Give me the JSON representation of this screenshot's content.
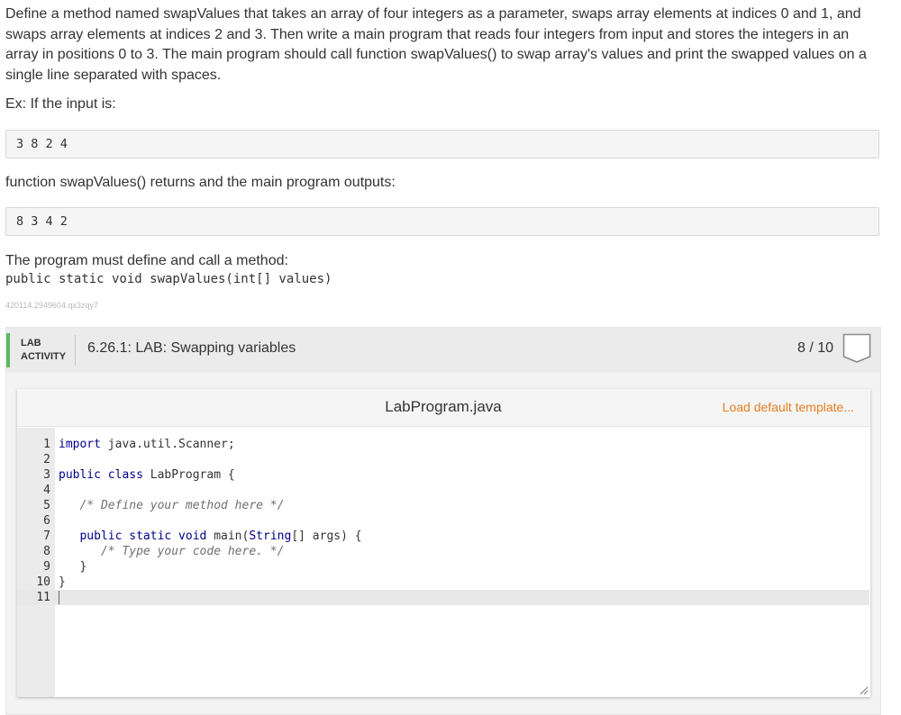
{
  "description": "Define a method named swapValues that takes an array of four integers as a parameter, swaps array elements at indices 0 and 1, and swaps array elements at indices 2 and 3. Then write a main program that reads four integers from input and stores the integers in an array in positions 0 to 3. The main program should call function swapValues() to swap array's values and print the swapped values on a single line separated with spaces.",
  "example_label": "Ex: If the input is:",
  "example_input": "3 8 2 4",
  "output_label": "function swapValues() returns and the main program outputs:",
  "example_output": "8 3 4 2",
  "must_label": "The program must define and call a method:",
  "method_signature": "public static void swapValues(int[] values)",
  "problem_id": "420114.2949604.qx3zqy7",
  "lab": {
    "activity_line1": "LAB",
    "activity_line2": "ACTIVITY",
    "title": "6.26.1: LAB: Swapping variables",
    "score": "8 / 10",
    "accent_color": "#5cb85c"
  },
  "editor": {
    "file_name": "LabProgram.java",
    "load_default": "Load default template...",
    "link_color": "#e67e22",
    "lines": [
      {
        "num": "1",
        "parts": [
          {
            "t": "import",
            "c": "kw"
          },
          {
            "t": " java.util.Scanner;",
            "c": ""
          }
        ]
      },
      {
        "num": "2",
        "parts": []
      },
      {
        "num": "3",
        "parts": [
          {
            "t": "public class",
            "c": "kw"
          },
          {
            "t": " LabProgram {",
            "c": ""
          }
        ]
      },
      {
        "num": "4",
        "parts": []
      },
      {
        "num": "5",
        "parts": [
          {
            "t": "   ",
            "c": ""
          },
          {
            "t": "/* Define your method here */",
            "c": "cm"
          }
        ]
      },
      {
        "num": "6",
        "parts": []
      },
      {
        "num": "7",
        "parts": [
          {
            "t": "   ",
            "c": ""
          },
          {
            "t": "public static void",
            "c": "kw"
          },
          {
            "t": " main(",
            "c": ""
          },
          {
            "t": "String",
            "c": "kw"
          },
          {
            "t": "[] args) {",
            "c": ""
          }
        ]
      },
      {
        "num": "8",
        "parts": [
          {
            "t": "      ",
            "c": ""
          },
          {
            "t": "/* Type your code here. */",
            "c": "cm"
          }
        ]
      },
      {
        "num": "9",
        "parts": [
          {
            "t": "   }",
            "c": ""
          }
        ]
      },
      {
        "num": "10",
        "parts": [
          {
            "t": "}",
            "c": ""
          }
        ]
      },
      {
        "num": "11",
        "parts": [],
        "active": true
      }
    ]
  }
}
